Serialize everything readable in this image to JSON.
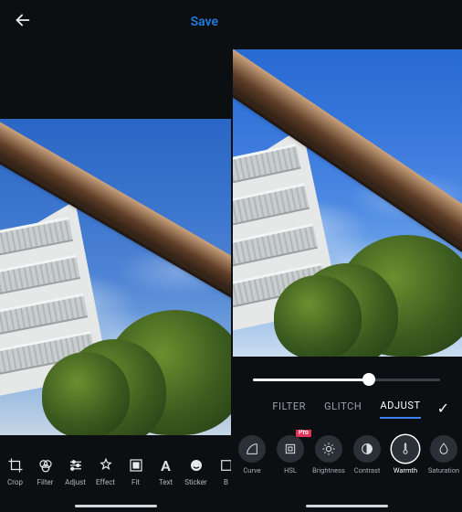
{
  "left": {
    "save_label": "Save",
    "tools": [
      {
        "id": "crop",
        "label": "Crop"
      },
      {
        "id": "filter",
        "label": "Filter"
      },
      {
        "id": "adjust",
        "label": "Adjust"
      },
      {
        "id": "effect",
        "label": "Effect"
      },
      {
        "id": "fit",
        "label": "Fit"
      },
      {
        "id": "text",
        "label": "Text"
      },
      {
        "id": "sticker",
        "label": "Sticker"
      },
      {
        "id": "brush",
        "label": "B"
      }
    ]
  },
  "right": {
    "slider": {
      "percent": 62
    },
    "tabs": {
      "filter": "FILTER",
      "glitch": "GLITCH",
      "adjust": "ADJUST",
      "active": "adjust"
    },
    "confirm_glyph": "✓",
    "adjustments": [
      {
        "id": "curve",
        "label": "Curve",
        "active": false,
        "pro": false
      },
      {
        "id": "hsl",
        "label": "HSL",
        "active": false,
        "pro": true,
        "pro_label": "Pro"
      },
      {
        "id": "brightness",
        "label": "Brightness",
        "active": false,
        "pro": false
      },
      {
        "id": "contrast",
        "label": "Contrast",
        "active": false,
        "pro": false
      },
      {
        "id": "warmth",
        "label": "Warmth",
        "active": true,
        "pro": false
      },
      {
        "id": "saturation",
        "label": "Saturation",
        "active": false,
        "pro": false
      }
    ]
  }
}
